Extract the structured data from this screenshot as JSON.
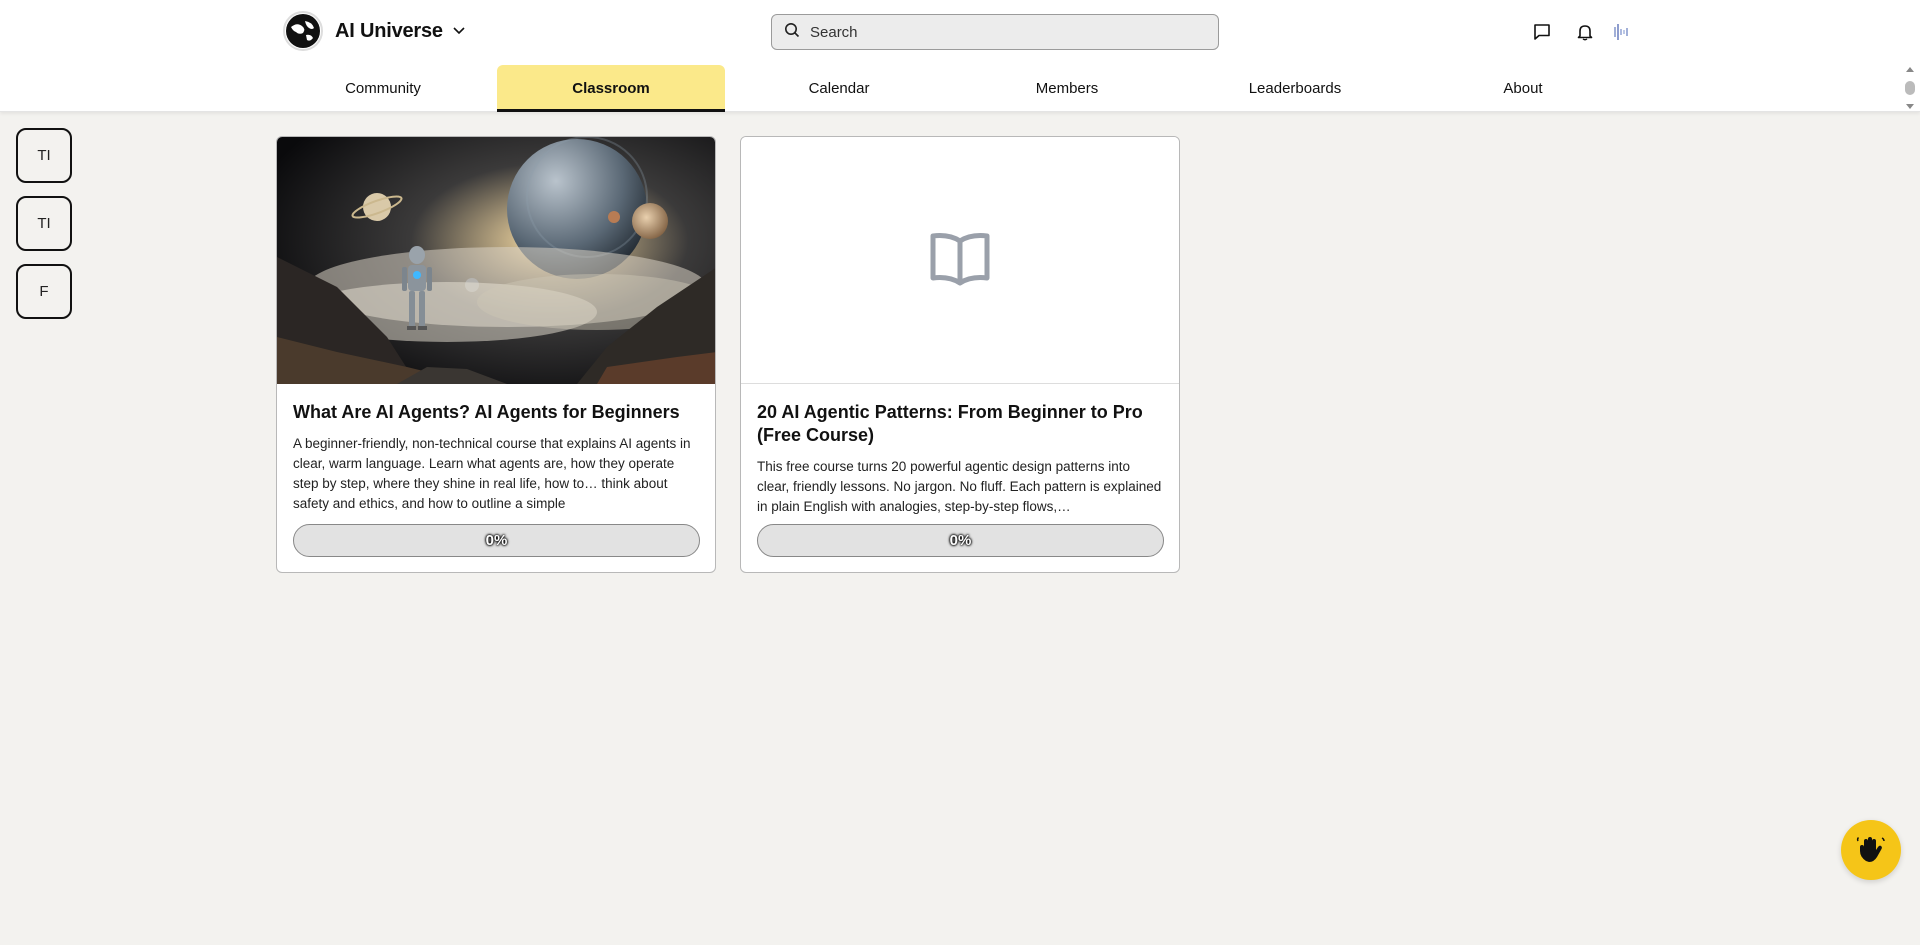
{
  "header": {
    "brand_name": "AI Universe",
    "search_placeholder": "Search"
  },
  "nav": {
    "tabs": [
      {
        "label": "Community",
        "active": false
      },
      {
        "label": "Classroom",
        "active": true
      },
      {
        "label": "Calendar",
        "active": false
      },
      {
        "label": "Members",
        "active": false
      },
      {
        "label": "Leaderboards",
        "active": false
      },
      {
        "label": "About",
        "active": false
      }
    ]
  },
  "sidebar": {
    "items": [
      {
        "label": "TI"
      },
      {
        "label": "TI"
      },
      {
        "label": "F"
      }
    ]
  },
  "courses": [
    {
      "title": "What Are AI Agents? AI Agents for Beginners",
      "description": "A beginner-friendly, non-technical course that explains AI agents in clear, warm language. Learn what agents are, how they operate step by step, where they shine in real life, how to… think about safety and ethics, and how to outline a simple",
      "progress_label": "0%",
      "progress": 0
    },
    {
      "title": "20 AI Agentic Patterns: From Beginner to Pro (Free Course)",
      "description": "This free course turns 20 powerful agentic design patterns into clear, friendly lessons. No jargon. No fluff. Each pattern is explained in plain English with analogies, step-by-step flows,…",
      "progress_label": "0%",
      "progress": 0
    }
  ],
  "colors": {
    "accent": "#f5c518",
    "active_tab": "#fbe98a",
    "background": "#f3f2ef"
  },
  "icons": {
    "chat": "chat-icon",
    "bell": "bell-icon",
    "course_placeholder": "open-book-icon",
    "fab": "hand-wave-icon"
  }
}
